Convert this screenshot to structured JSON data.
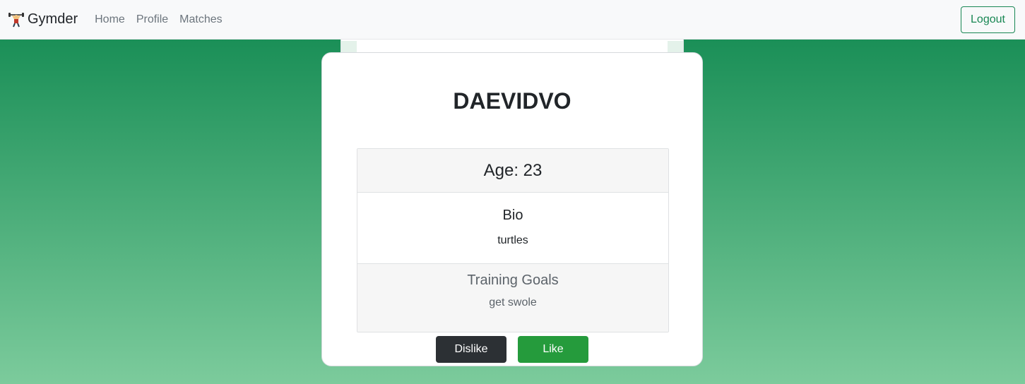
{
  "nav": {
    "brand": "Gymder",
    "brand_icon": "weightlifter-icon",
    "links": [
      "Home",
      "Profile",
      "Matches"
    ],
    "logout_label": "Logout"
  },
  "profile": {
    "name": "DAEVIDVO",
    "age_label": "Age: 23",
    "bio_title": "Bio",
    "bio_text": "turtles",
    "goals_title": "Training Goals",
    "goals_text": "get swole"
  },
  "actions": {
    "dislike_label": "Dislike",
    "like_label": "Like"
  },
  "colors": {
    "brand_green": "#198754",
    "like_green": "#259b3c",
    "dislike_dark": "#2c3034"
  }
}
